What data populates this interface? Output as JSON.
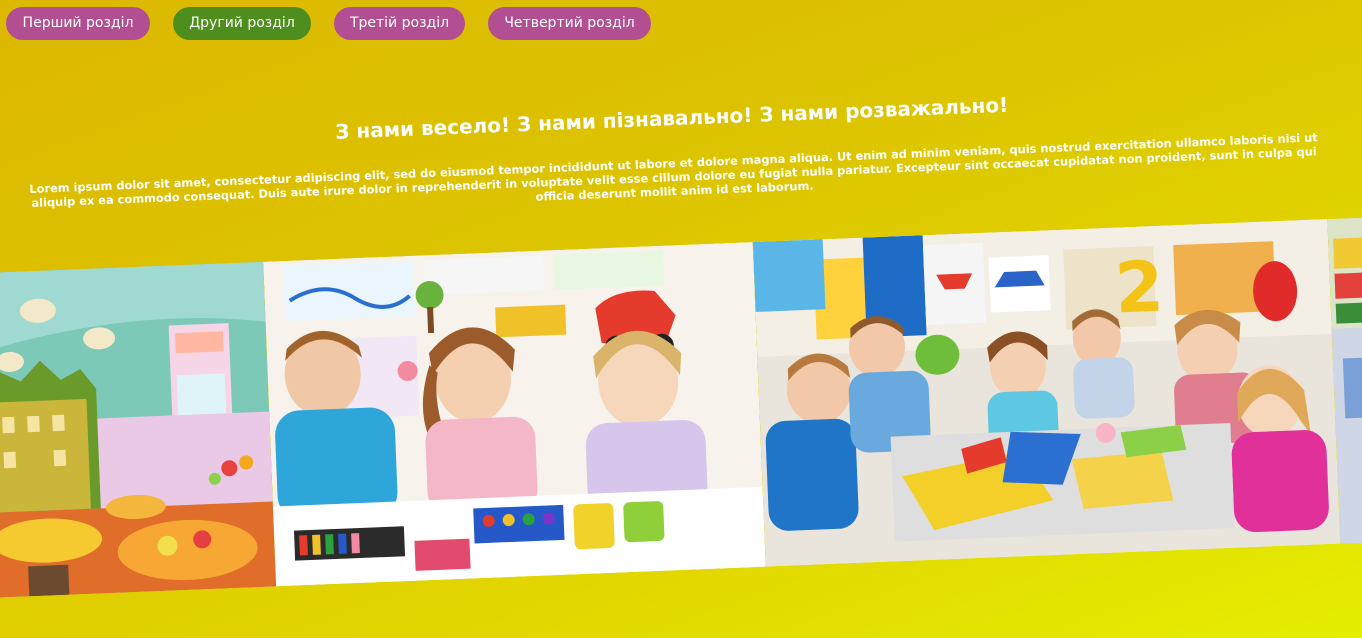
{
  "nav": {
    "items": [
      {
        "label": "Перший розділ",
        "color": "#b24f92"
      },
      {
        "label": "Другий розділ",
        "color": "#4d8e1d"
      },
      {
        "label": "Третій розділ",
        "color": "#b24f92"
      },
      {
        "label": "Четвертий розділ",
        "color": "#b24f92"
      }
    ]
  },
  "hero": {
    "headline": "З нами весело! З нами пізнавально! З нами розважально!",
    "text": "Lorem ipsum dolor sit amet, consectetur adipiscing elit, sed do eiusmod tempor incididunt ut labore et dolore magna aliqua. Ut enim ad minim veniam, quis nostrud exercitation ullamco laboris nisi ut aliquip ex ea commodo consequat. Duis aute irure dolor in reprehenderit in voluptate velit esse cillum dolore eu fugiat nulla pariatur. Excepteur sint occaecat cupidatat non proident, sunt in culpa qui officia deserunt mollit anim id est laborum."
  },
  "gallery": {
    "photos": [
      {
        "icon": "cartoon-classroom-image"
      },
      {
        "icon": "children-painting-image"
      },
      {
        "icon": "children-crafting-image"
      },
      {
        "icon": "toy-shelf-image"
      }
    ]
  },
  "colors": {
    "nav_default": "#b24f92",
    "nav_active": "#4d8e1d",
    "background_top": "#dcb800",
    "background_bottom": "#e4ee00"
  }
}
